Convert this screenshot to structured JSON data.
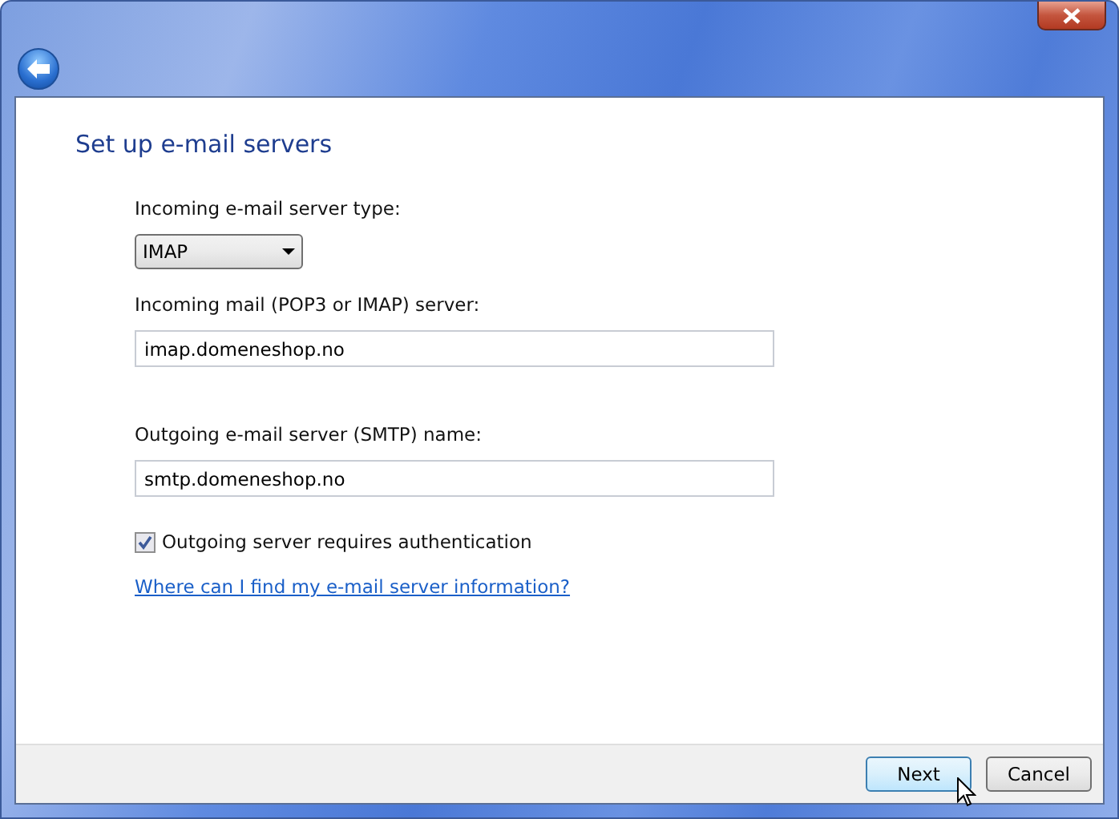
{
  "heading": "Set up e-mail servers",
  "server_type": {
    "label": "Incoming e-mail server type:",
    "value": "IMAP"
  },
  "fields": [
    {
      "label": "Incoming mail (POP3 or IMAP) server:",
      "value": "imap.domeneshop.no"
    },
    {
      "label": "Outgoing e-mail server (SMTP) name:",
      "value": "smtp.domeneshop.no"
    }
  ],
  "auth": {
    "label": "Outgoing server requires authentication",
    "checked": true
  },
  "help_link": "Where can I find my e-mail server information?",
  "buttons": [
    {
      "label": "Next",
      "default": true
    },
    {
      "label": "Cancel",
      "default": false
    }
  ]
}
